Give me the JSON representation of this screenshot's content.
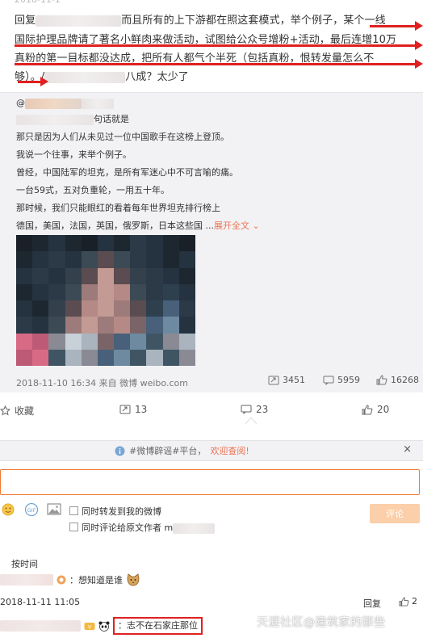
{
  "post": {
    "ghost_text": "2018-11-1",
    "line1_prefix": "回复",
    "line1_middle": "而且所有的上下游都在照这套模式，举个例子，",
    "line1_underlined": "某个一线",
    "line2_underlined": "国际护理品牌请了著名小鲜肉来做活动，试图给公众号增粉+活动，最后连增10万",
    "line3_underlined": "真粉的第一目标都没达成，把所有人都气个半死（包括真粉，恨转发量怎么不",
    "line4_underlined": "够）",
    "line4_sep": "。/",
    "line4_suffix": "八成？太少了"
  },
  "repost": {
    "at": "@",
    "line1": "句话就是",
    "line2": "那只是因为人们从未见过一位中国歌手在这榜上登顶。",
    "line3": "我说一个往事，来举个例子。",
    "line4": "曾经，中国陆军的坦克，是所有军迷心中不可言喻的痛。",
    "line5": "一台59式，五对负重轮，一用五十年。",
    "line6": "那时候，我们只能眼红的看着每年世界坦克排行榜上",
    "line7": "德国，美国，法国，英国，俄罗斯，日本这些国",
    "ellipsis": "...",
    "expand": "展开全文",
    "meta": "2018-11-10 16:34 来自 微博 weibo.com",
    "stat_repost": "3451",
    "stat_comment": "5959",
    "stat_like": "16268"
  },
  "actions": {
    "favorite": "收藏",
    "repost": "13",
    "comment": "23",
    "like": "20"
  },
  "banner": {
    "prefix": "#微博辟谣#平台，",
    "link": "欢迎查阅!",
    "close": "×"
  },
  "composer": {
    "chk1": "同时转发到我的微博",
    "chk2": "同时评论给原文作者",
    "chk2_tail": "m",
    "submit": "评论"
  },
  "comments": {
    "sort": "按时间",
    "c1_text": "：想知道是谁",
    "c1_time": "2018-11-11 11:05",
    "reply": "回复",
    "c1_likes": "2",
    "c2_text": "志不在石家庄那位"
  },
  "watermark": "天涯社区@建筑家的那些",
  "colors": {
    "accent_orange": "#eb7350",
    "annotation_red": "#e02020",
    "submit_disabled": "#fbcfa9"
  }
}
